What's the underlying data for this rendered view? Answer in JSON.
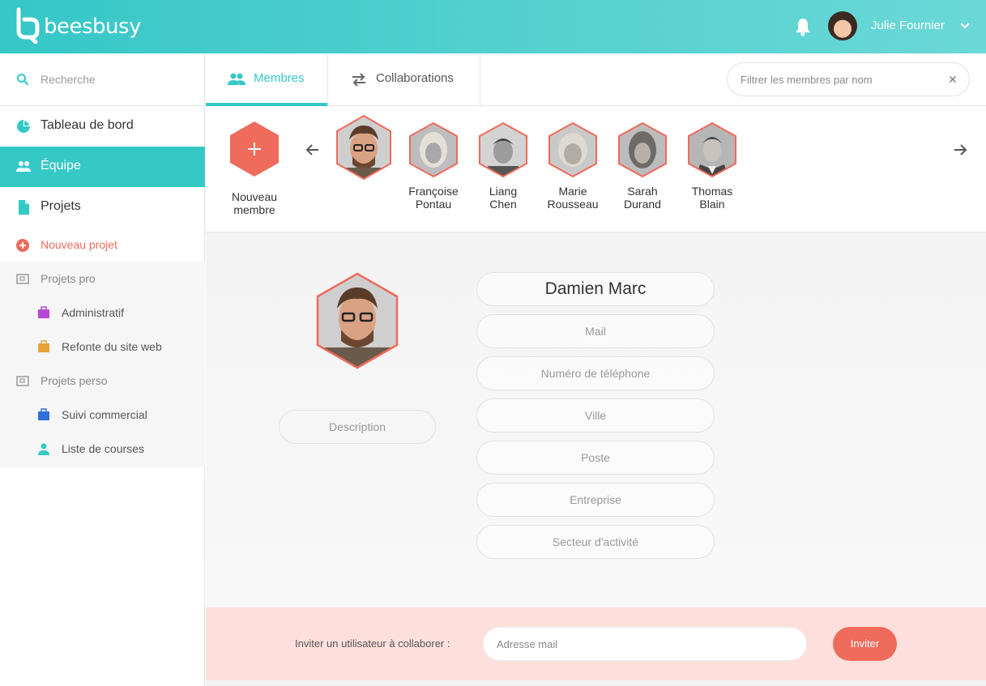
{
  "app": {
    "brand": "beesbusy",
    "user_name": "Julie Fournier",
    "accent": "#35c9c6",
    "coral": "#ef6b5b"
  },
  "sidebar": {
    "search_placeholder": "Recherche",
    "nav": [
      {
        "label": "Tableau de bord",
        "icon": "dashboard-pie-icon"
      },
      {
        "label": "Équipe",
        "icon": "team-icon",
        "active": true
      },
      {
        "label": "Projets",
        "icon": "document-icon"
      }
    ],
    "new_project": "Nouveau projet",
    "groups": [
      {
        "label": "Projets pro",
        "items": [
          {
            "label": "Administratif",
            "color": "#b54ad1"
          },
          {
            "label": "Refonte du site web",
            "color": "#e8a33a"
          }
        ]
      },
      {
        "label": "Projets perso",
        "items": [
          {
            "label": "Suivi commercial",
            "color": "#2f6fd6"
          },
          {
            "label": "Liste de courses",
            "color": "#35c9c6"
          }
        ]
      }
    ]
  },
  "tabs": {
    "members": "Membres",
    "collaborations": "Collaborations",
    "filter_placeholder": "Filtrer les membres par nom",
    "clear": "✕"
  },
  "strip": {
    "new_member": [
      "Nouveau",
      "membre"
    ],
    "members": [
      {
        "first": "",
        "last": "",
        "selected": true
      },
      {
        "first": "Françoise",
        "last": "Pontau"
      },
      {
        "first": "Liang",
        "last": "Chen"
      },
      {
        "first": "Marie",
        "last": "Rousseau"
      },
      {
        "first": "Sarah",
        "last": "Durand"
      },
      {
        "first": "Thomas",
        "last": "Blain"
      }
    ]
  },
  "detail": {
    "name": "Damien Marc",
    "description_placeholder": "Description",
    "fields": [
      "Mail",
      "Numéro de téléphone",
      "Ville",
      "Poste",
      "Entreprise",
      "Secteur d'activité"
    ]
  },
  "invite": {
    "label": "Inviter un utilisateur à collaborer :",
    "placeholder": "Adresse mail",
    "button": "Inviter"
  }
}
